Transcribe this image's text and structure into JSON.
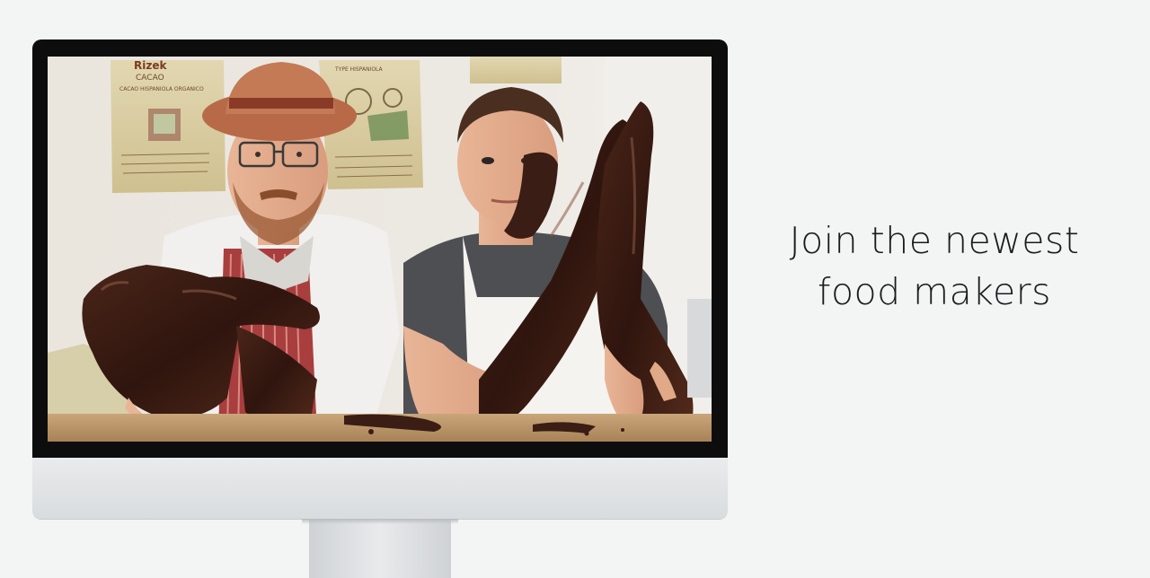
{
  "hero": {
    "headline_line1": "Join the newest",
    "headline_line2": "food makers",
    "photo_alt": "Two chocolate makers with chocolate-covered arms",
    "sack_labels": {
      "left_brand": "Rizek",
      "left_line1": "CACAO",
      "left_line2": "CACAO HISPANIOLA ORGANICO",
      "right_line1": "TYPE HISPANIOLA"
    }
  },
  "colors": {
    "background": "#f3f5f5",
    "headline": "#1b1b1d",
    "bezel": "#0d0d0e",
    "chocolate": "#3a1d14"
  }
}
